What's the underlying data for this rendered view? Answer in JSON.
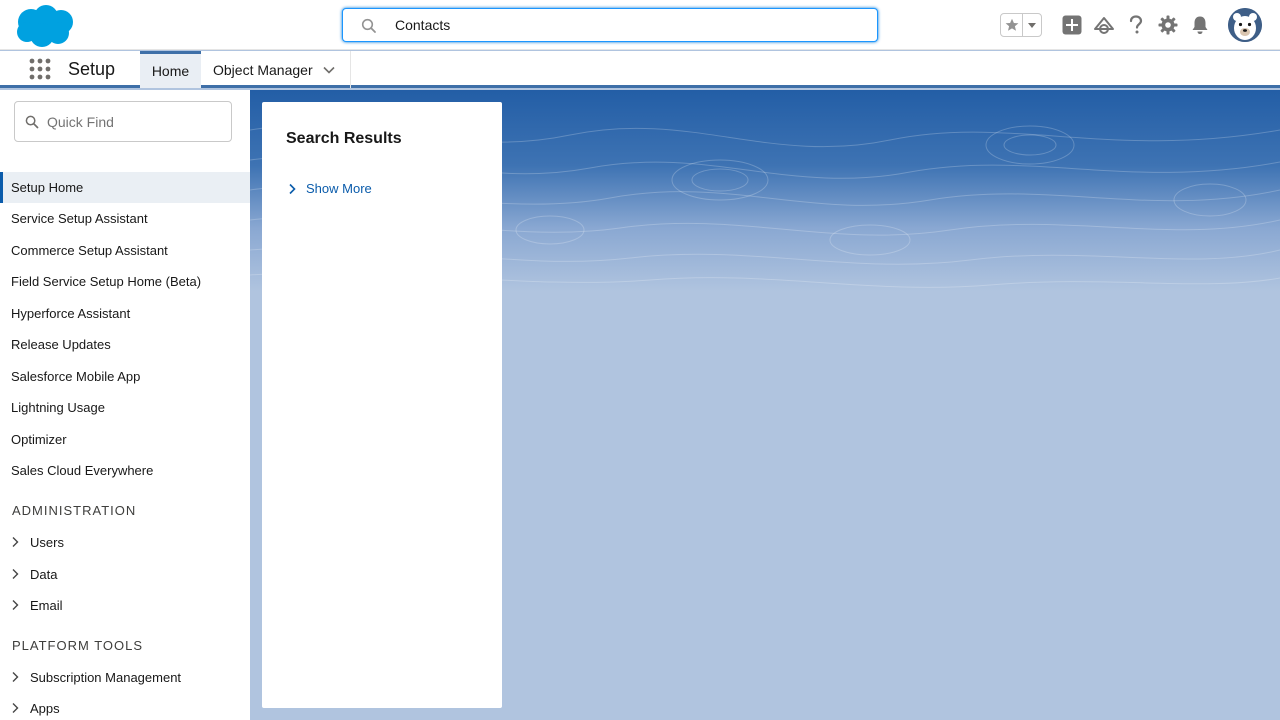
{
  "header": {
    "search": {
      "value": "Contacts"
    }
  },
  "context": {
    "app_name": "Setup",
    "tabs": [
      {
        "label": "Home",
        "active": true
      },
      {
        "label": "Object Manager",
        "active": false
      }
    ]
  },
  "sidebar": {
    "quick_find_placeholder": "Quick Find",
    "items": [
      {
        "label": "Setup Home",
        "active": true
      },
      {
        "label": "Service Setup Assistant"
      },
      {
        "label": "Commerce Setup Assistant"
      },
      {
        "label": "Field Service Setup Home (Beta)"
      },
      {
        "label": "Hyperforce Assistant"
      },
      {
        "label": "Release Updates"
      },
      {
        "label": "Salesforce Mobile App"
      },
      {
        "label": "Lightning Usage"
      },
      {
        "label": "Optimizer"
      },
      {
        "label": "Sales Cloud Everywhere"
      }
    ],
    "sections": [
      {
        "title": "ADMINISTRATION",
        "items": [
          "Users",
          "Data",
          "Email"
        ]
      },
      {
        "title": "PLATFORM TOOLS",
        "items": [
          "Subscription Management",
          "Apps"
        ]
      }
    ]
  },
  "main": {
    "panel_title": "Search Results",
    "show_more": "Show More"
  },
  "colors": {
    "brand": "#00a1e0",
    "accent_blue": "#0b5cab",
    "background": "#b0c4df"
  },
  "icons": [
    "salesforce-cloud-icon",
    "search-icon",
    "star-icon",
    "chevron-down-icon",
    "plus-icon",
    "trailhead-icon",
    "help-icon",
    "gear-icon",
    "bell-icon",
    "avatar-icon",
    "app-launcher-icon",
    "chevron-right-icon"
  ]
}
